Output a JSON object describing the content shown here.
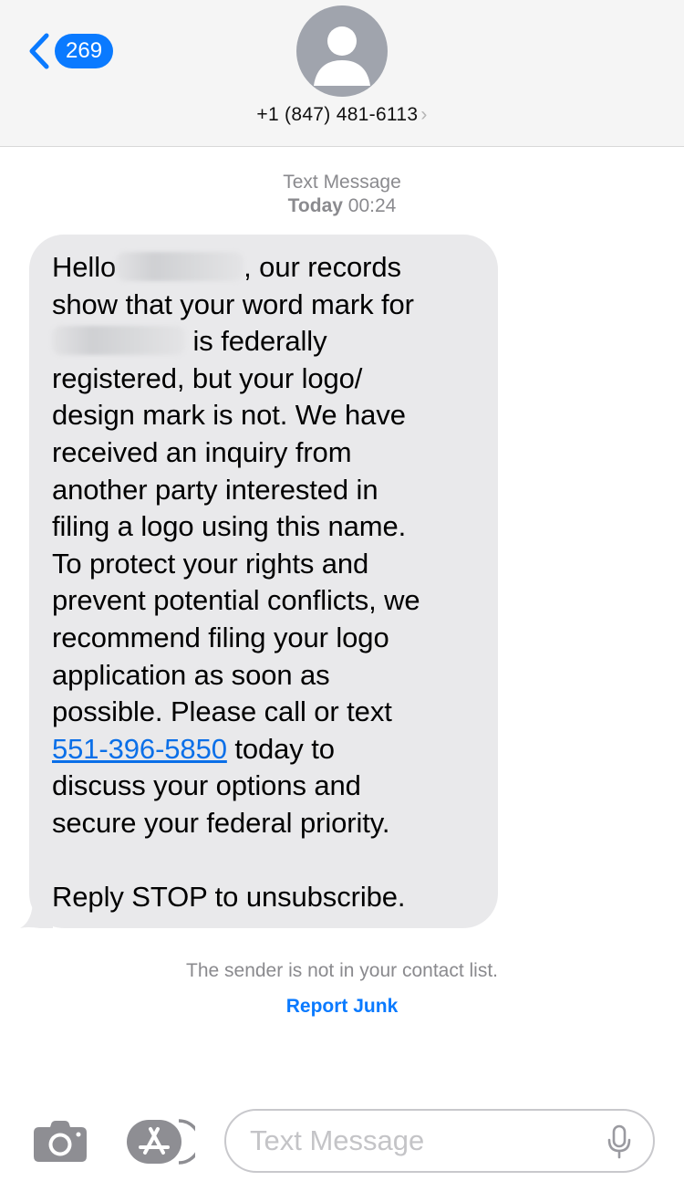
{
  "header": {
    "back_count": "269",
    "contact_name": "+1 (847) 481-6113",
    "contact_chevron": "›"
  },
  "thread": {
    "service": "Text Message",
    "day": "Today",
    "time": "00:24"
  },
  "message": {
    "line1_pre": "Hello",
    "line1_post": ", our records",
    "line2": "show that your word mark for",
    "line3_post": " is federally",
    "body_middle": "registered, but your logo/\ndesign mark is not. We have\nreceived an inquiry from\nanother party interested in\nfiling a logo using this name.\nTo protect your rights and\nprevent potential conflicts, we\nrecommend filing your logo\napplication as soon as\npossible. Please call or text",
    "phone_link": "551-396-5850",
    "after_link": " today to",
    "body_end": "discuss your options and\nsecure your federal priority.\n\nReply STOP to unsubscribe."
  },
  "notice": {
    "text": "The sender is not in your contact list.",
    "report_label": "Report Junk"
  },
  "composer": {
    "placeholder": "Text Message"
  },
  "colors": {
    "accent": "#0a7aff",
    "bubble": "#e9e9eb",
    "header_bg": "#f5f5f5"
  },
  "icons": {
    "back": "chevron-left-icon",
    "avatar": "person-icon",
    "camera": "camera-icon",
    "apps": "app-store-icon",
    "mic": "microphone-icon"
  }
}
